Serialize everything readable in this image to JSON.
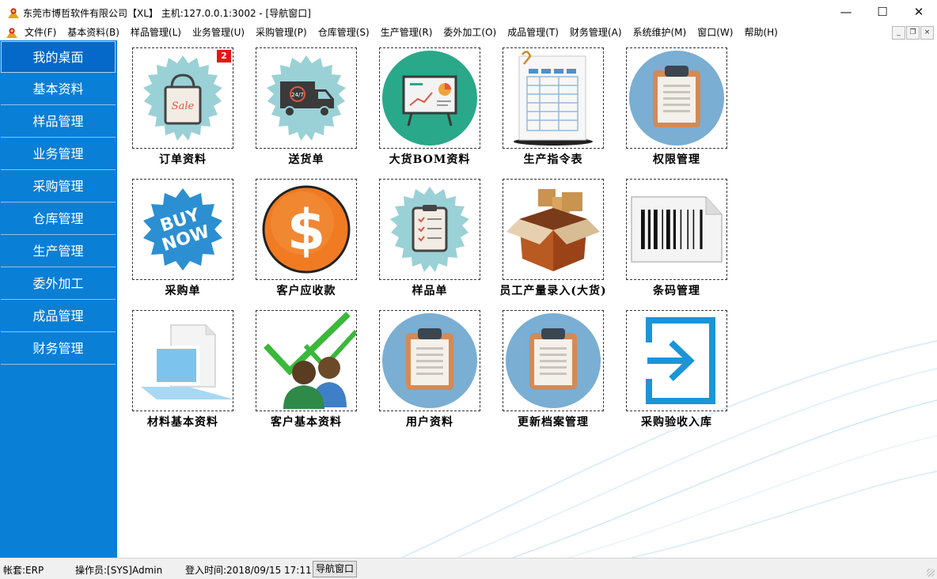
{
  "window": {
    "title": "东莞市博哲软件有限公司【XL】 主机:127.0.0.1:3002 - [导航窗口]",
    "controls": {
      "minimize": "—",
      "maximize": "☐",
      "close": "✕"
    }
  },
  "menu": {
    "items": [
      "文件(F)",
      "基本资料(B)",
      "样品管理(L)",
      "业务管理(U)",
      "采购管理(P)",
      "仓库管理(S)",
      "生产管理(R)",
      "委外加工(O)",
      "成品管理(T)",
      "财务管理(A)",
      "系统维护(M)",
      "窗口(W)",
      "帮助(H)"
    ],
    "mdi": {
      "minimize": "_",
      "restore": "❐",
      "close": "×"
    }
  },
  "sidebar": {
    "items": [
      "我的桌面",
      "基本资料",
      "样品管理",
      "业务管理",
      "采购管理",
      "仓库管理",
      "生产管理",
      "委外加工",
      "成品管理",
      "财务管理"
    ],
    "active_index": 0
  },
  "tiles": [
    {
      "label": "订单资料",
      "icon": "shopping-bag-icon",
      "badge": "2"
    },
    {
      "label": "送货单",
      "icon": "delivery-truck-icon",
      "truck_text": "24/7"
    },
    {
      "label": "大货BOM资料",
      "icon": "presentation-chart-icon"
    },
    {
      "label": "生产指令表",
      "icon": "spreadsheet-icon"
    },
    {
      "label": "权限管理",
      "icon": "clipboard-icon"
    },
    {
      "label": "采购单",
      "icon": "buy-now-icon",
      "icon_text": [
        "BUY",
        "NOW"
      ]
    },
    {
      "label": "客户应收款",
      "icon": "dollar-icon",
      "icon_text": "$"
    },
    {
      "label": "样品单",
      "icon": "checklist-icon"
    },
    {
      "label": "员工产量录入(大货)",
      "icon": "cardboard-box-icon"
    },
    {
      "label": "条码管理",
      "icon": "barcode-icon"
    },
    {
      "label": "材料基本资料",
      "icon": "document-monitor-icon"
    },
    {
      "label": "客户基本资料",
      "icon": "users-checkmark-icon"
    },
    {
      "label": "用户资料",
      "icon": "clipboard-icon"
    },
    {
      "label": "更新档案管理",
      "icon": "clipboard-icon"
    },
    {
      "label": "采购验收入库",
      "icon": "sign-in-arrow-icon"
    }
  ],
  "status": {
    "account": "帐套:ERP",
    "operator": "操作员:[SYS]Admin",
    "login_time": "登入时间:2018/09/15 17:11",
    "window_button": "导航窗口"
  },
  "colors": {
    "sidebar": "#0a7fd6",
    "sidebar_active": "#0469c8",
    "badge": "#e81414",
    "accent": "#1a95d8"
  }
}
